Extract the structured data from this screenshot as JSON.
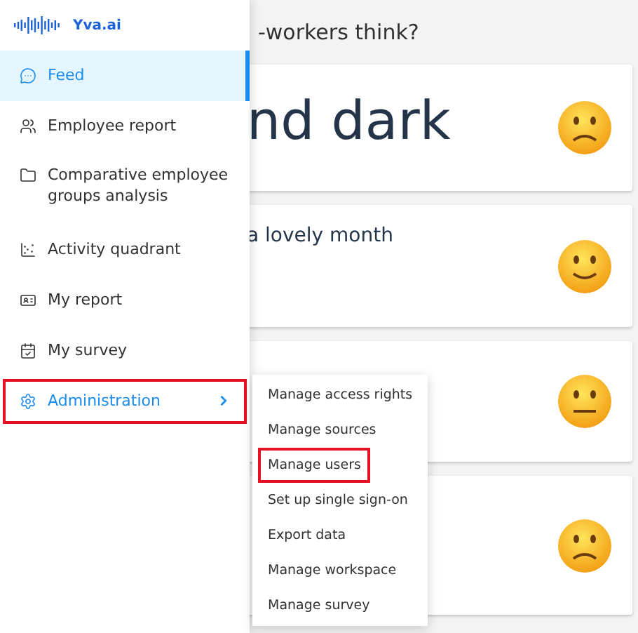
{
  "brand": {
    "name": "Yva.ai"
  },
  "sidebar": {
    "items": [
      {
        "label": "Feed",
        "selected": true,
        "highlighted": false,
        "has_submenu": false
      },
      {
        "label": "Employee report",
        "selected": false,
        "highlighted": false,
        "has_submenu": false
      },
      {
        "label": "Comparative employee groups analysis",
        "selected": false,
        "highlighted": false,
        "has_submenu": false
      },
      {
        "label": "Activity quadrant",
        "selected": false,
        "highlighted": false,
        "has_submenu": false
      },
      {
        "label": "My report",
        "selected": false,
        "highlighted": false,
        "has_submenu": false
      },
      {
        "label": "My survey",
        "selected": false,
        "highlighted": false,
        "has_submenu": false
      },
      {
        "label": "Administration",
        "selected": false,
        "highlighted": true,
        "has_submenu": true
      }
    ]
  },
  "main": {
    "heading": "-workers think?",
    "cards": [
      {
        "kind": "sad",
        "text": "nd dark"
      },
      {
        "kind": "happy",
        "text": "a lovely month"
      },
      {
        "kind": "neutral"
      },
      {
        "kind": "sad"
      }
    ]
  },
  "submenu": {
    "items": [
      {
        "label": "Manage access rights",
        "highlighted": false
      },
      {
        "label": "Manage sources",
        "highlighted": false
      },
      {
        "label": "Manage users",
        "highlighted": true
      },
      {
        "label": "Set up single sign-on",
        "highlighted": false
      },
      {
        "label": "Export data",
        "highlighted": false
      },
      {
        "label": "Manage workspace",
        "highlighted": false
      },
      {
        "label": "Manage survey",
        "highlighted": false
      }
    ]
  }
}
